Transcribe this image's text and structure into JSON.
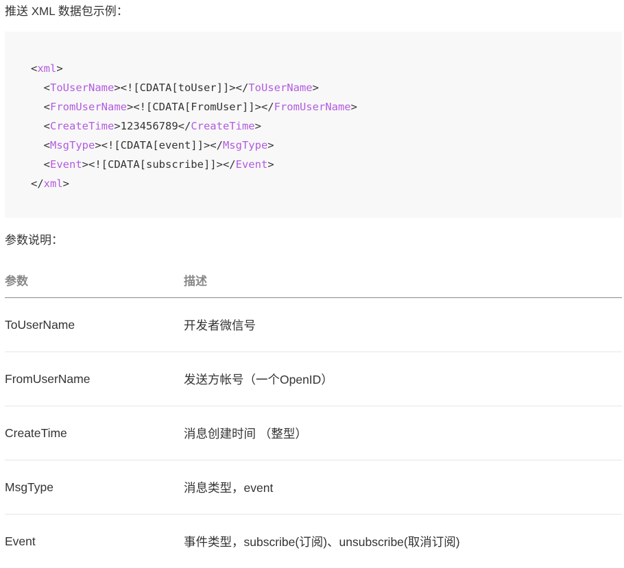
{
  "intro": "推送 XML 数据包示例：",
  "code_lines": [
    [
      {
        "t": "",
        "c": "txt"
      },
      {
        "t": "<",
        "c": "txt"
      },
      {
        "t": "xml",
        "c": "tag"
      },
      {
        "t": ">",
        "c": "txt"
      }
    ],
    [
      {
        "t": "  <",
        "c": "txt"
      },
      {
        "t": "ToUserName",
        "c": "tag"
      },
      {
        "t": "><![CDATA[toUser]]></",
        "c": "txt"
      },
      {
        "t": "ToUserName",
        "c": "tag"
      },
      {
        "t": ">",
        "c": "txt"
      }
    ],
    [
      {
        "t": "  <",
        "c": "txt"
      },
      {
        "t": "FromUserName",
        "c": "tag"
      },
      {
        "t": "><![CDATA[FromUser]]></",
        "c": "txt"
      },
      {
        "t": "FromUserName",
        "c": "tag"
      },
      {
        "t": ">",
        "c": "txt"
      }
    ],
    [
      {
        "t": "  <",
        "c": "txt"
      },
      {
        "t": "CreateTime",
        "c": "tag"
      },
      {
        "t": ">123456789</",
        "c": "txt"
      },
      {
        "t": "CreateTime",
        "c": "tag"
      },
      {
        "t": ">",
        "c": "txt"
      }
    ],
    [
      {
        "t": "  <",
        "c": "txt"
      },
      {
        "t": "MsgType",
        "c": "tag"
      },
      {
        "t": "><![CDATA[event]]></",
        "c": "txt"
      },
      {
        "t": "MsgType",
        "c": "tag"
      },
      {
        "t": ">",
        "c": "txt"
      }
    ],
    [
      {
        "t": "  <",
        "c": "txt"
      },
      {
        "t": "Event",
        "c": "tag"
      },
      {
        "t": "><![CDATA[subscribe]]></",
        "c": "txt"
      },
      {
        "t": "Event",
        "c": "tag"
      },
      {
        "t": ">",
        "c": "txt"
      }
    ],
    [
      {
        "t": "</",
        "c": "txt"
      },
      {
        "t": "xml",
        "c": "tag"
      },
      {
        "t": ">",
        "c": "txt"
      }
    ]
  ],
  "params_label": "参数说明：",
  "table": {
    "headers": [
      "参数",
      "描述"
    ],
    "rows": [
      [
        "ToUserName",
        "开发者微信号"
      ],
      [
        "FromUserName",
        "发送方帐号（一个OpenID）"
      ],
      [
        "CreateTime",
        "消息创建时间 （整型）"
      ],
      [
        "MsgType",
        "消息类型，event"
      ],
      [
        "Event",
        "事件类型，subscribe(订阅)、unsubscribe(取消订阅)"
      ]
    ]
  },
  "colors": {
    "tag": "#b35be0",
    "code_bg": "#f8f8f8",
    "header_text": "#888888"
  }
}
